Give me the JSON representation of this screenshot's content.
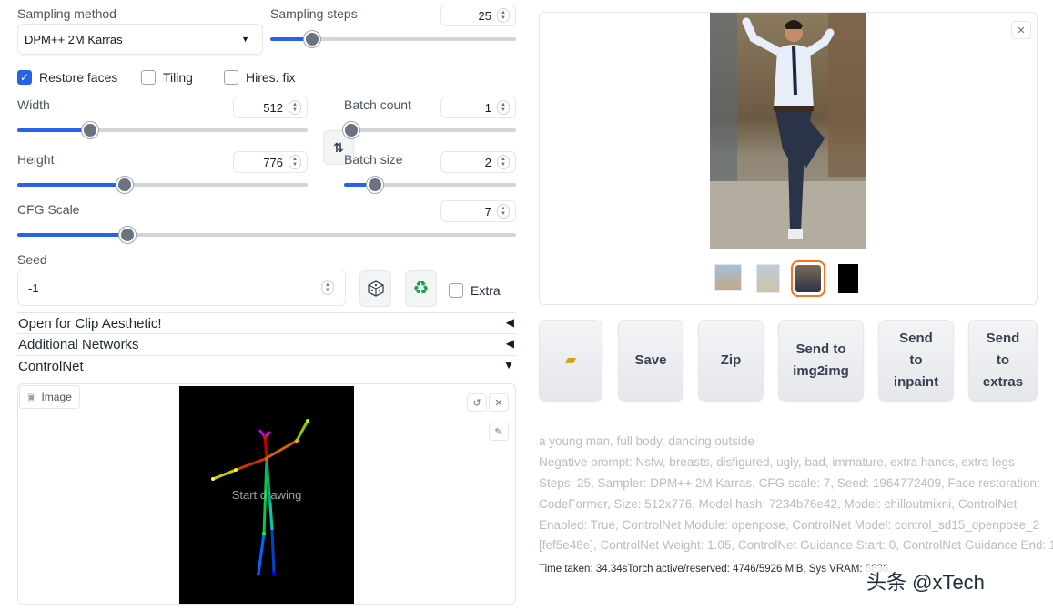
{
  "sampling": {
    "method_label": "Sampling method",
    "method_value": "DPM++ 2M Karras",
    "steps_label": "Sampling steps",
    "steps_value": "25",
    "steps_level": 0.17
  },
  "checkboxes": {
    "restore_faces": {
      "label": "Restore faces",
      "checked": true
    },
    "tiling": {
      "label": "Tiling",
      "checked": false
    },
    "hires_fix": {
      "label": "Hires. fix",
      "checked": false
    },
    "extra": {
      "label": "Extra",
      "checked": false
    }
  },
  "dims": {
    "width_label": "Width",
    "width_value": "512",
    "width_level": 0.25,
    "height_label": "Height",
    "height_value": "776",
    "height_level": 0.37,
    "swap_icon": "swap-arrows-icon"
  },
  "batch": {
    "count_label": "Batch count",
    "count_value": "1",
    "count_level": 0.04,
    "size_label": "Batch size",
    "size_value": "2",
    "size_level": 0.18
  },
  "cfg": {
    "label": "CFG Scale",
    "value": "7",
    "level": 0.22
  },
  "seed": {
    "label": "Seed",
    "value": "-1",
    "dice_icon": "dice-icon",
    "recycle_icon": "recycle-icon"
  },
  "accordions": {
    "clip": "Open for Clip Aesthetic!",
    "networks": "Additional Networks",
    "controlnet": "ControlNet"
  },
  "controlnet": {
    "image_tab": "Image",
    "canvas_hint": "Start drawing"
  },
  "actions": {
    "folder_icon": "folder-icon",
    "save": "Save",
    "zip": "Zip",
    "img2img": [
      "Send to",
      "img2img"
    ],
    "inpaint": [
      "Send",
      "to",
      "inpaint"
    ],
    "extras": [
      "Send",
      "to",
      "extras"
    ]
  },
  "info_lines": [
    "a young man, full body, dancing outside",
    "Negative prompt: Nsfw, breasts, disfigured, ugly, bad, immature, extra hands, extra legs",
    "Steps: 25, Sampler: DPM++ 2M Karras, CFG scale: 7, Seed: 1964772409, Face restoration:",
    "CodeFormer, Size: 512x776, Model hash: 7234b76e42, Model: chilloutmixni, ControlNet",
    "Enabled: True, ControlNet Module: openpose, ControlNet Model: control_sd15_openpose_2",
    "[fef5e48e], ControlNet Weight: 1.05, ControlNet Guidance Start: 0, ControlNet Guidance End: 1"
  ],
  "time_taken": "Time taken: 34.34sTorch active/reserved: 4746/5926 MiB, Sys VRAM: 6836",
  "watermark": "头条 @xTech",
  "colors": {
    "accent": "#2563eb",
    "selected_thumb": "#f97316"
  }
}
